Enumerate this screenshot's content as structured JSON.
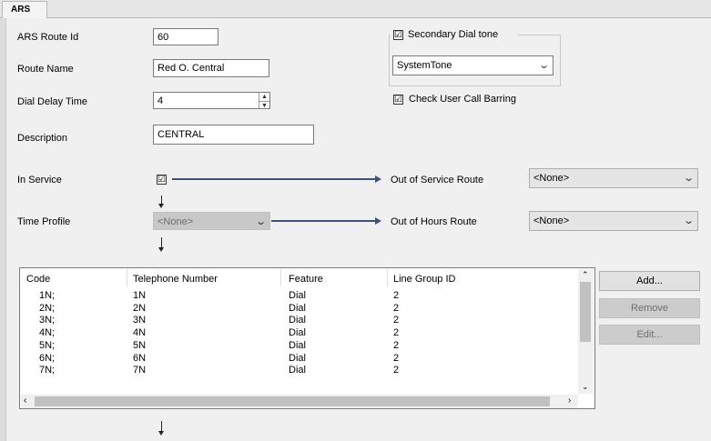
{
  "tab": {
    "label": "ARS"
  },
  "fields": {
    "route_id": {
      "label": "ARS Route Id",
      "value": "60"
    },
    "route_name": {
      "label": "Route Name",
      "value": "Red O. Central"
    },
    "dial_delay": {
      "label": "Dial Delay Time",
      "value": "4"
    },
    "description": {
      "label": "Description",
      "value": "CENTRAL"
    },
    "in_service": {
      "label": "In Service",
      "checked": true
    },
    "time_profile": {
      "label": "Time Profile",
      "value": "<None>"
    }
  },
  "secondary_dial_tone": {
    "label": "Secondary Dial tone",
    "checked": true,
    "value": "SystemTone"
  },
  "check_user_call_barring": {
    "label": "Check User Call Barring",
    "checked": true
  },
  "out_of_service": {
    "label": "Out of Service Route",
    "value": "<None>"
  },
  "out_of_hours": {
    "label": "Out of Hours Route",
    "value": "<None>"
  },
  "check_glyph": "☑",
  "chevron_glyph": "⌄",
  "table": {
    "columns": [
      "Code",
      "Telephone Number",
      "Feature",
      "Line Group ID"
    ],
    "rows": [
      [
        "1N;",
        "1N",
        "Dial",
        "2"
      ],
      [
        "2N;",
        "2N",
        "Dial",
        "2"
      ],
      [
        "3N;",
        "3N",
        "Dial",
        "2"
      ],
      [
        "4N;",
        "4N",
        "Dial",
        "2"
      ],
      [
        "5N;",
        "5N",
        "Dial",
        "2"
      ],
      [
        "6N;",
        "6N",
        "Dial",
        "2"
      ],
      [
        "7N;",
        "7N",
        "Dial",
        "2"
      ]
    ]
  },
  "buttons": {
    "add": "Add...",
    "remove": "Remove",
    "edit": "Edit..."
  },
  "colors": {
    "flow_arrow": "#3f5178",
    "window_bg": "#f0f0f0"
  },
  "icons": {
    "up": "scroll-up-icon",
    "down": "scroll-down-icon",
    "left": "scroll-left-icon",
    "right": "scroll-right-icon"
  }
}
